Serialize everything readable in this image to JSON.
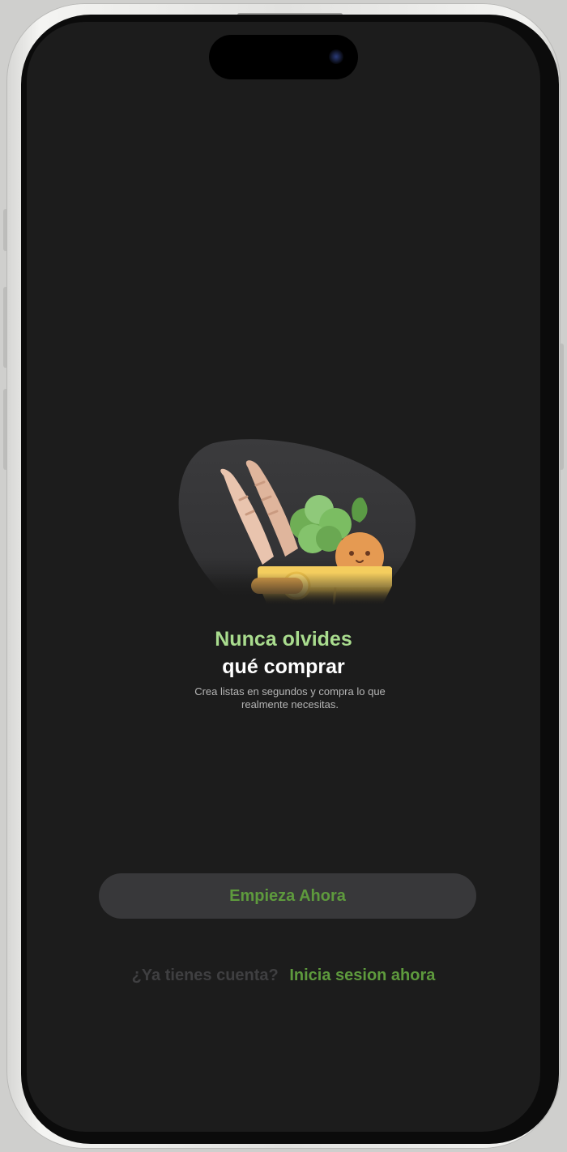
{
  "onboarding": {
    "title_line1": "Nunca olvides",
    "title_line2": "qué comprar",
    "subtitle": "Crea listas en segundos y compra lo que realmente necesitas.",
    "start_button": "Empieza Ahora",
    "account_question": "¿Ya tienes cuenta?",
    "login_link": "Inicia sesion ahora"
  },
  "illustration": {
    "subject": "grocery-basket",
    "items": [
      "baguette",
      "lettuce",
      "orange"
    ]
  },
  "colors": {
    "background": "#1c1c1c",
    "accent_green": "#a9dc8e",
    "button_text_green": "#5e9a3d",
    "button_bg": "#38383a",
    "basket_yellow": "#f2c94c"
  }
}
